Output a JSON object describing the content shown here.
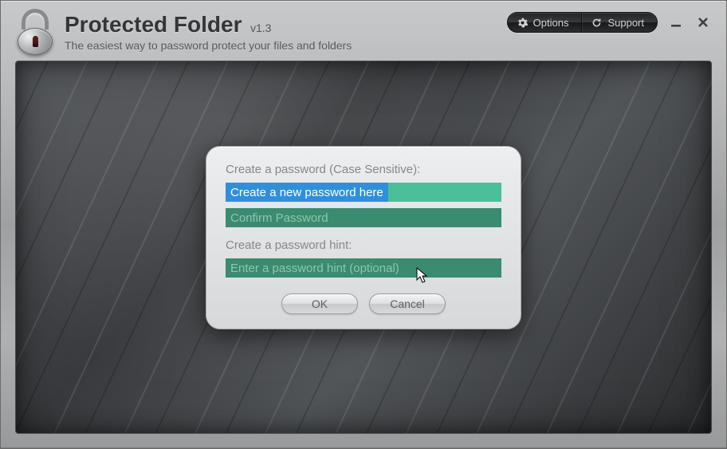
{
  "app": {
    "title": "Protected Folder",
    "version": "v1.3",
    "tagline": "The easiest way to password protect your files and folders"
  },
  "topControls": {
    "options": "Options",
    "support": "Support"
  },
  "dialog": {
    "createLabel": "Create a password (Case Sensitive):",
    "newPlaceholder": "Create a new password here",
    "confirmPlaceholder": "Confirm Password",
    "hintLabel": "Create a password hint:",
    "hintPlaceholder": "Enter a password hint (optional)",
    "ok": "OK",
    "cancel": "Cancel"
  },
  "icons": {
    "gear": "gear-icon",
    "refresh": "refresh-icon",
    "lock": "lock-icon"
  }
}
